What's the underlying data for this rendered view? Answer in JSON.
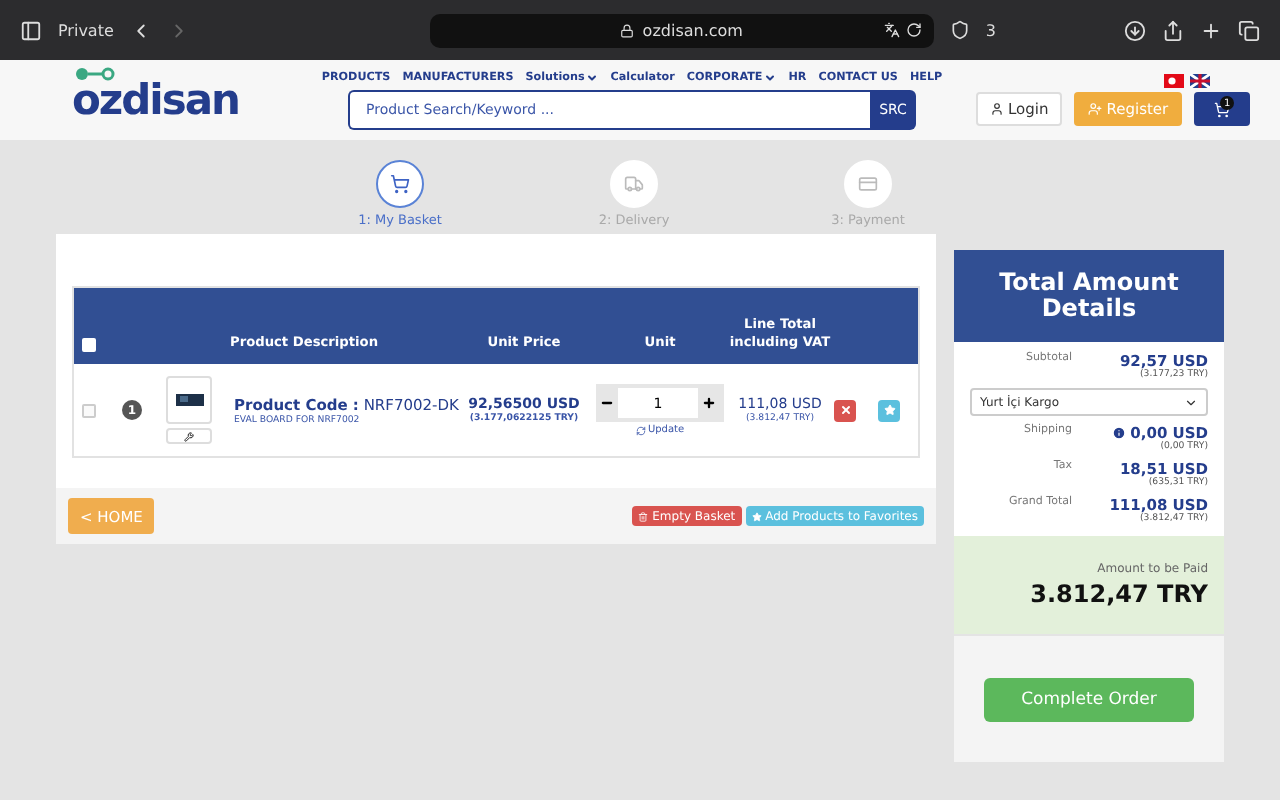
{
  "browser": {
    "private_label": "Private",
    "url": "ozdisan.com",
    "shield_count": "3"
  },
  "header": {
    "logo": "ozdisan",
    "nav": [
      {
        "label": "PRODUCTS",
        "dropdown": false
      },
      {
        "label": "MANUFACTURERS",
        "dropdown": false
      },
      {
        "label": "Solutions",
        "dropdown": true
      },
      {
        "label": "Calculator",
        "dropdown": false
      },
      {
        "label": "CORPORATE",
        "dropdown": true
      },
      {
        "label": "HR",
        "dropdown": false
      },
      {
        "label": "CONTACT US",
        "dropdown": false
      },
      {
        "label": "HELP",
        "dropdown": false
      }
    ],
    "search": {
      "placeholder": "Product Search/Keyword ...",
      "button": "SRC"
    },
    "login": "Login",
    "register": "Register",
    "cart_count": "1"
  },
  "steps": [
    {
      "label": "1: My Basket",
      "kind": "cart",
      "selected": true
    },
    {
      "label": "2: Delivery",
      "kind": "truck",
      "selected": false
    },
    {
      "label": "3: Payment",
      "kind": "card",
      "selected": false
    }
  ],
  "table": {
    "select_all_checked": false,
    "columns": [
      "Product Description",
      "Unit Price",
      "Unit",
      "Line Total including VAT"
    ],
    "rows": [
      {
        "checked": false,
        "index": "1",
        "code_label": "Product Code :",
        "code": "NRF7002-DK",
        "description": "EVAL BOARD FOR NRF7002",
        "unit_price": "92,56500 USD",
        "unit_price_try": "(3.177,0622125 TRY)",
        "quantity": "1",
        "update": "Update",
        "line_total": "111,08 USD",
        "line_total_try": "(3.812,47 TRY)"
      }
    ]
  },
  "actions": {
    "home": "< HOME",
    "empty": "Empty Basket",
    "favorites": "Add Products to Favorites"
  },
  "summary": {
    "title": "Total Amount Details",
    "shipping_option": "Yurt İçi Kargo",
    "lines": [
      {
        "label": "Subtotal",
        "value": "92,57 USD",
        "value_try": "(3.177,23 TRY)",
        "info": false
      },
      {
        "kind": "select"
      },
      {
        "label": "Shipping",
        "value": "0,00 USD",
        "value_try": "(0,00 TRY)",
        "info": true
      },
      {
        "label": "Tax",
        "value": "18,51 USD",
        "value_try": "(635,31 TRY)",
        "info": false
      },
      {
        "label": "Grand Total",
        "value": "111,08 USD",
        "value_try": "(3.812,47 TRY)",
        "info": false
      }
    ],
    "pay_label": "Amount to be Paid",
    "pay_value": "3.812,47 TRY",
    "complete": "Complete Order"
  }
}
